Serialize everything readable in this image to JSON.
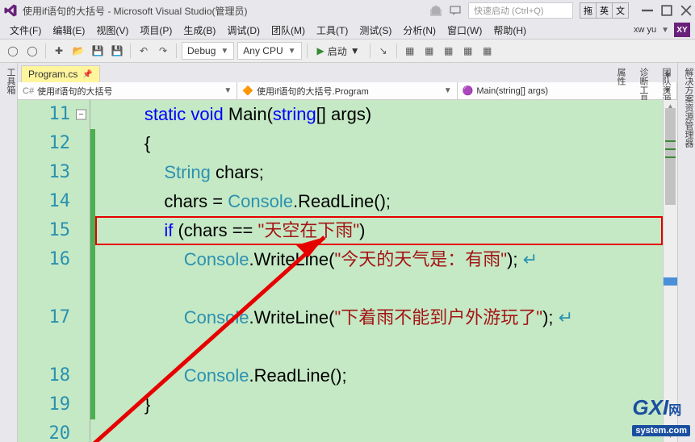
{
  "window": {
    "title": "使用if语句的大括号 - Microsoft Visual Studio(管理员)",
    "quick_launch_placeholder": "快速启动 (Ctrl+Q)",
    "ime": {
      "a": "拖",
      "b": "英",
      "c": "文"
    }
  },
  "menus": {
    "file": "文件(F)",
    "edit": "编辑(E)",
    "view": "视图(V)",
    "project": "项目(P)",
    "build": "生成(B)",
    "debug": "调试(D)",
    "team": "团队(M)",
    "tools": "工具(T)",
    "test": "测试(S)",
    "analyze": "分析(N)",
    "window": "窗口(W)",
    "help": "帮助(H)"
  },
  "user": {
    "name": "xw yu",
    "initials": "XY"
  },
  "toolbar": {
    "config": "Debug",
    "platform": "Any CPU",
    "start": "启动"
  },
  "side_panels": {
    "left": "工具箱",
    "right1": "解决方案资源管理器",
    "right2": "团队资源管理器",
    "right3": "诊断工具",
    "right4": "属性"
  },
  "tabs": {
    "active": "Program.cs"
  },
  "nav": {
    "scope": "使用if语句的大括号",
    "class": "使用if语句的大括号.Program",
    "member": "Main(string[] args)"
  },
  "code": {
    "lines": [
      "11",
      "12",
      "13",
      "14",
      "15",
      "16",
      "17",
      "18",
      "19",
      "20"
    ],
    "l11": {
      "kw1": "static",
      "kw2": "void",
      "name": "Main",
      "kw3": "string",
      "rest": "[] args)"
    },
    "l12": "{",
    "l13": {
      "type": "String",
      "rest": " chars;"
    },
    "l14": {
      "a": "chars = ",
      "type": "Console",
      "b": ".ReadLine();"
    },
    "l15": {
      "kw": "if",
      "a": " (chars == ",
      "str": "\"天空在下雨\"",
      "b": ")"
    },
    "l16": {
      "type": "Console",
      "a": ".WriteLine(",
      "str": "\"今天的天气是：有雨\"",
      "b": ");"
    },
    "l17": {
      "type": "Console",
      "a": ".WriteLine(",
      "str": "\"下着雨不能到户外游玩了\"",
      "b": ");"
    },
    "l18": {
      "type": "Console",
      "a": ".ReadLine();"
    },
    "l19": "}",
    "l20": ""
  },
  "watermark": {
    "brand": "GXI",
    "cn": "网",
    "sys": "system.com"
  }
}
